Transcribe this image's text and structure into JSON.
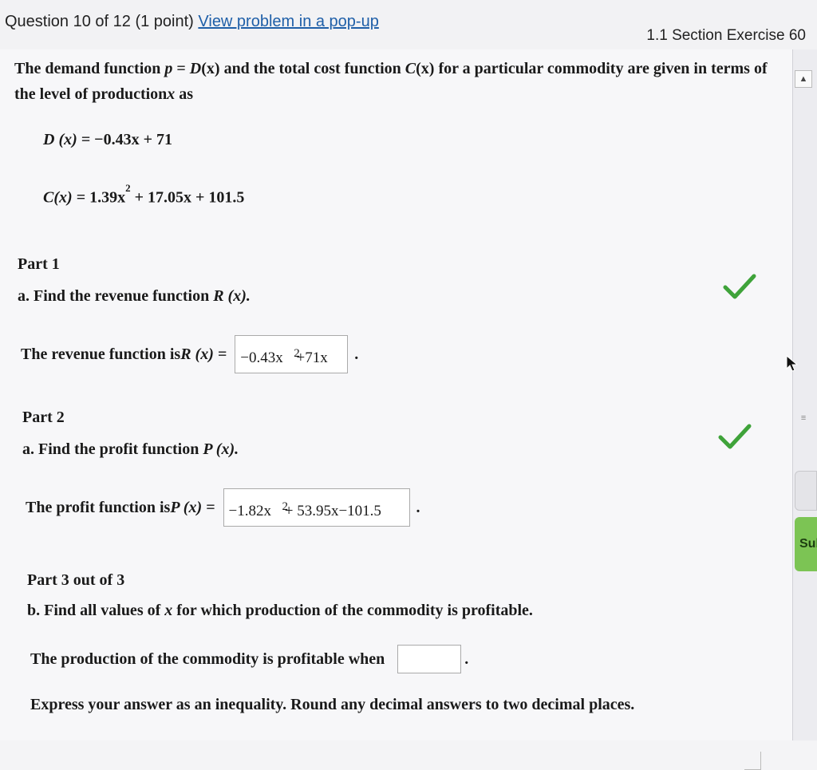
{
  "header": {
    "question_label": "Question 10 of 12 (1 point)",
    "popup_link": "View problem in a pop-up",
    "section": "1.1 Section Exercise 60"
  },
  "intro": {
    "text_a": "The demand function ",
    "p": "p",
    "eq_sign": " = ",
    "D": "D",
    "x1": "(x)",
    "text_b": " and the total cost function ",
    "C": "C",
    "x2": "(x)",
    "text_c": " for a particular commodity are given in terms of the level of production",
    "x3": "x",
    "text_d": " as"
  },
  "equations": {
    "demand_lhs": "D (x) = ",
    "demand_rhs": "−0.43x + 71",
    "cost_lhs": "C(x) = ",
    "cost_part1": "1.39x",
    "cost_exp": "2",
    "cost_part2": " + 17.05x + 101.5"
  },
  "part1": {
    "title": "Part 1",
    "prompt_a": "a. Find the revenue function ",
    "prompt_b": "R (x).",
    "answer_label_a": "The revenue function is ",
    "answer_label_b": "R (x) = ",
    "answer_coef": "−0.43x",
    "answer_exp": "2",
    "answer_rest": " +71x",
    "period": "."
  },
  "part2": {
    "title": "Part 2",
    "prompt_a": "a. Find the profit function ",
    "prompt_b": "P (x).",
    "answer_label_a": "The profit function is ",
    "answer_label_b": "P (x) = ",
    "answer_coef": "−1.82x",
    "answer_exp": "2",
    "answer_rest": " + 53.95x−101.5",
    "period": "."
  },
  "part3": {
    "title": "Part 3 out of 3",
    "prompt_a": "b. Find all values of ",
    "prompt_x": "x",
    "prompt_b": " for which production of the commodity is profitable.",
    "answer_label": "The production of the commodity is profitable when",
    "period": ".",
    "instruction": "Express your answer as an inequality. Round any decimal answers to two decimal places."
  },
  "side": {
    "submit_label": "Submit",
    "grip_glyph": "≡"
  },
  "colors": {
    "check_green": "#3fa33a",
    "link_blue": "#1f5fa8",
    "submit_green": "#7cc454"
  }
}
